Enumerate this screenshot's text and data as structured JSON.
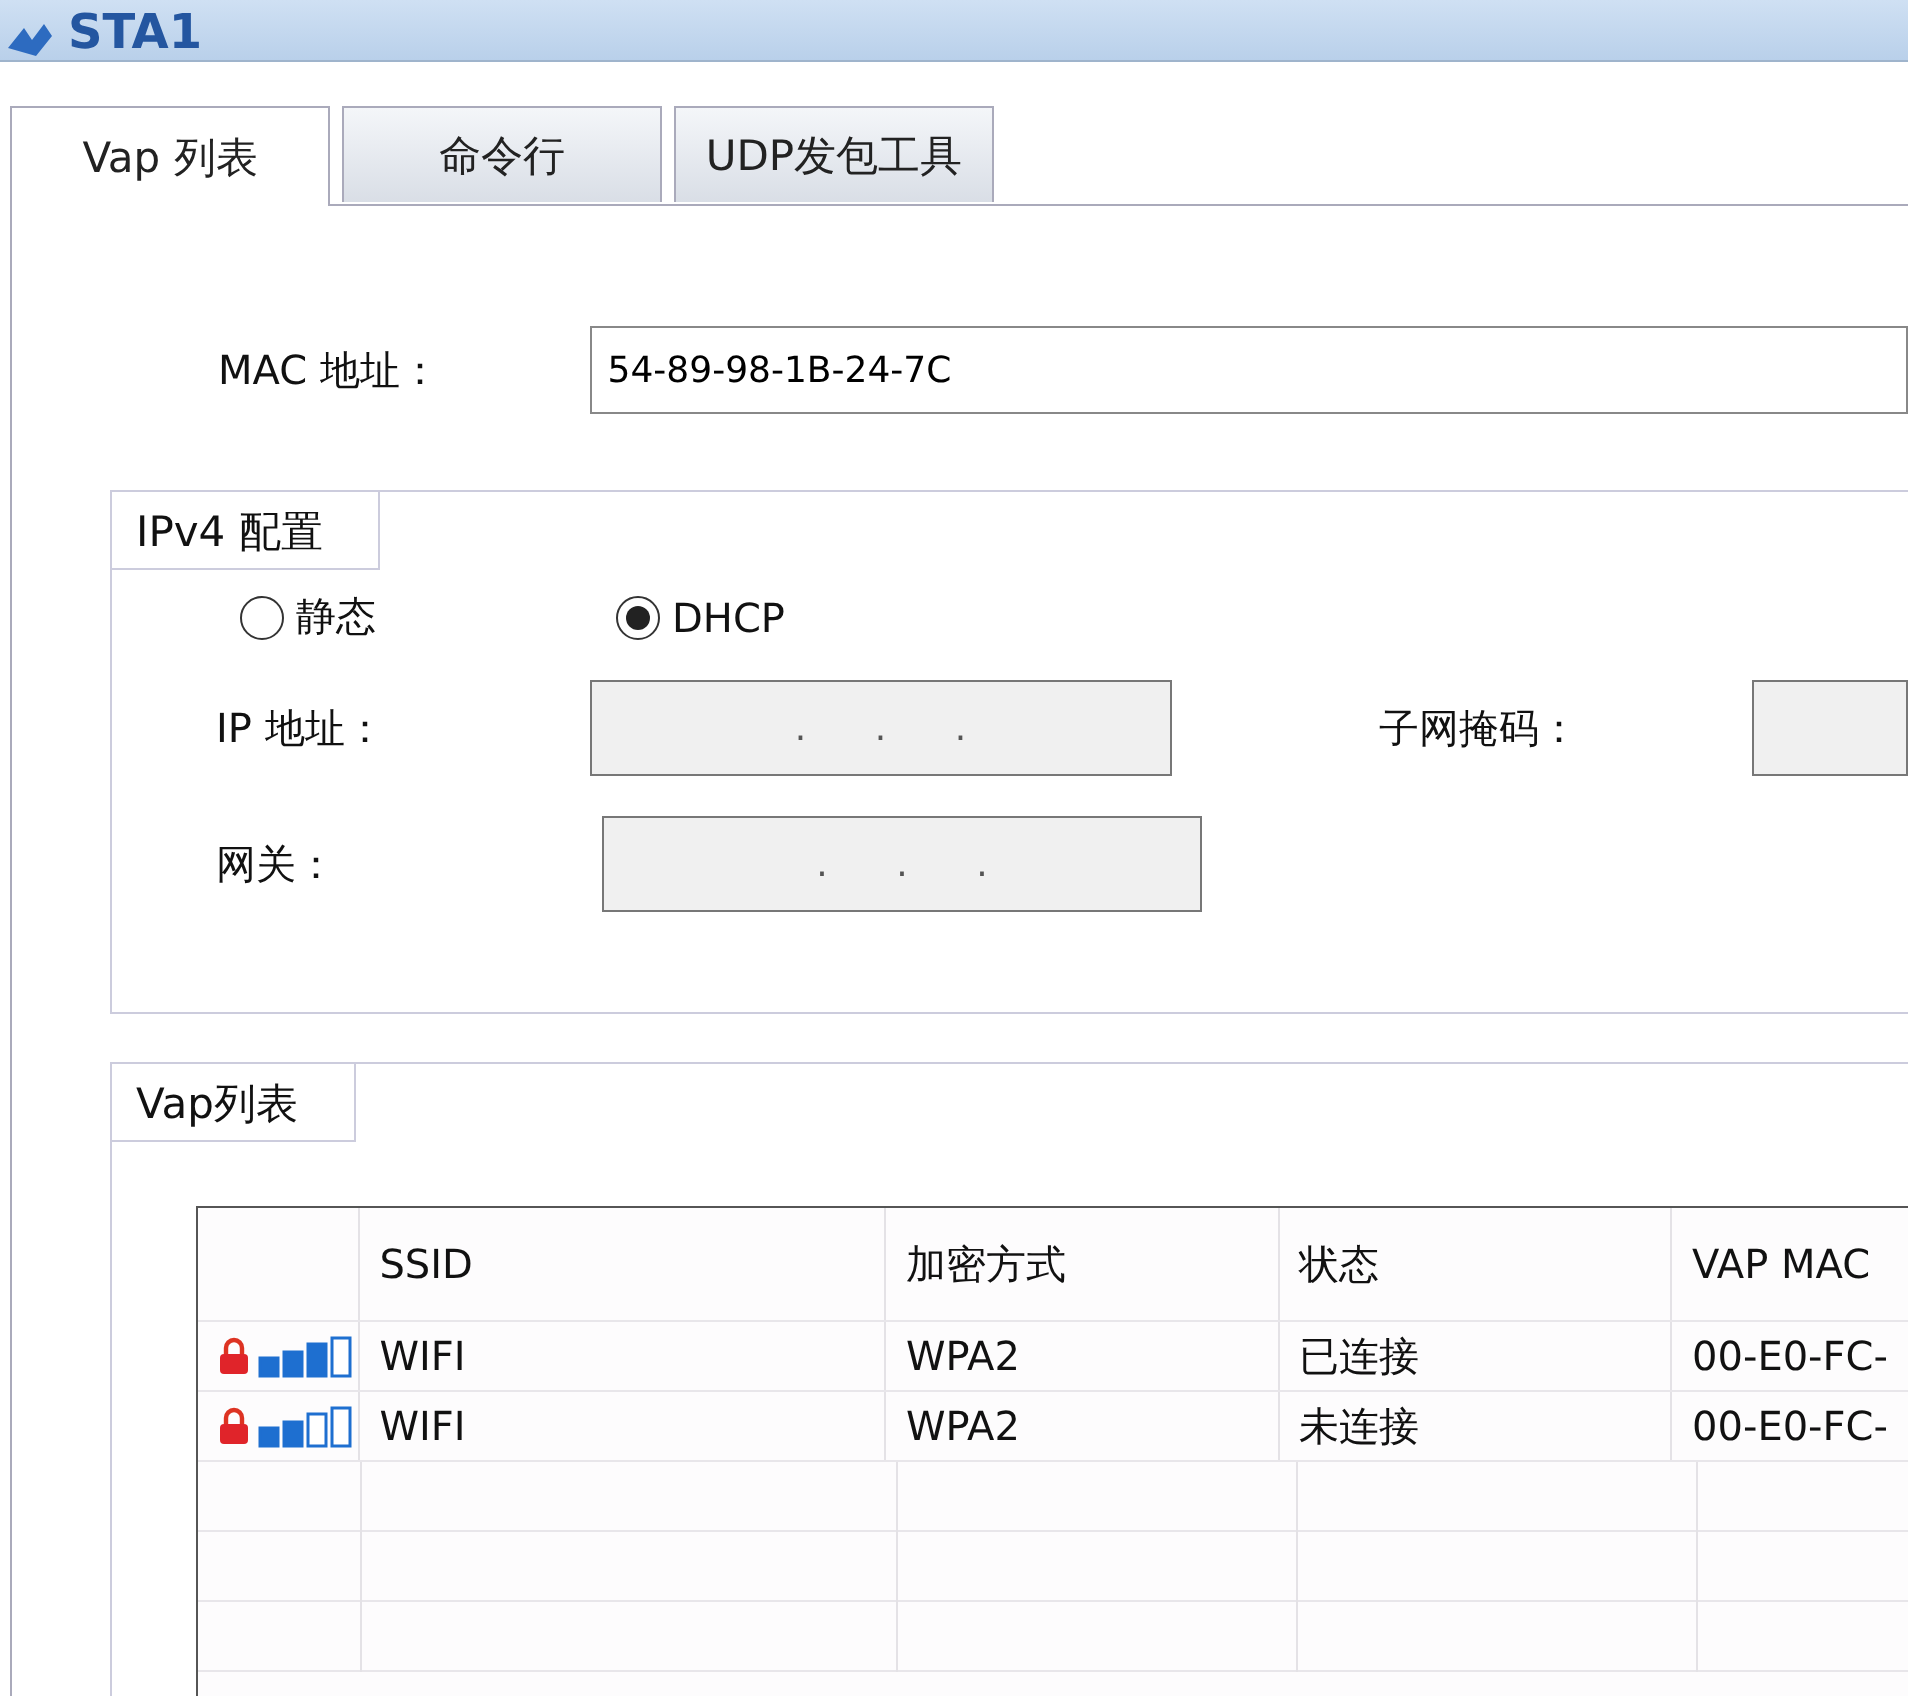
{
  "window": {
    "title": "STA1"
  },
  "tabs": [
    {
      "label": "Vap 列表",
      "selected": true
    },
    {
      "label": "命令行",
      "selected": false
    },
    {
      "label": "UDP发包工具",
      "selected": false
    }
  ],
  "mac": {
    "label": "MAC 地址：",
    "value": "54-89-98-1B-24-7C"
  },
  "ipv4": {
    "title": "IPv4 配置",
    "modes": [
      {
        "label": "静态",
        "selected": false
      },
      {
        "label": "DHCP",
        "selected": true
      }
    ],
    "ip": {
      "label": "IP 地址：",
      "value": ".      .      ."
    },
    "mask": {
      "label": "子网掩码："
    },
    "gateway": {
      "label": "网关：",
      "value": ".      .      ."
    }
  },
  "vap": {
    "title": "Vap列表",
    "columns": [
      "SSID",
      "加密方式",
      "状态",
      "VAP MAC"
    ],
    "rows": [
      {
        "kind": "strong",
        "cells": [
          "WIFI",
          "WPA2",
          "已连接",
          "00-E0-FC-"
        ]
      },
      {
        "kind": "weak",
        "cells": [
          "WIFI",
          "WPA2",
          "未连接",
          "00-E0-FC-"
        ]
      }
    ]
  }
}
